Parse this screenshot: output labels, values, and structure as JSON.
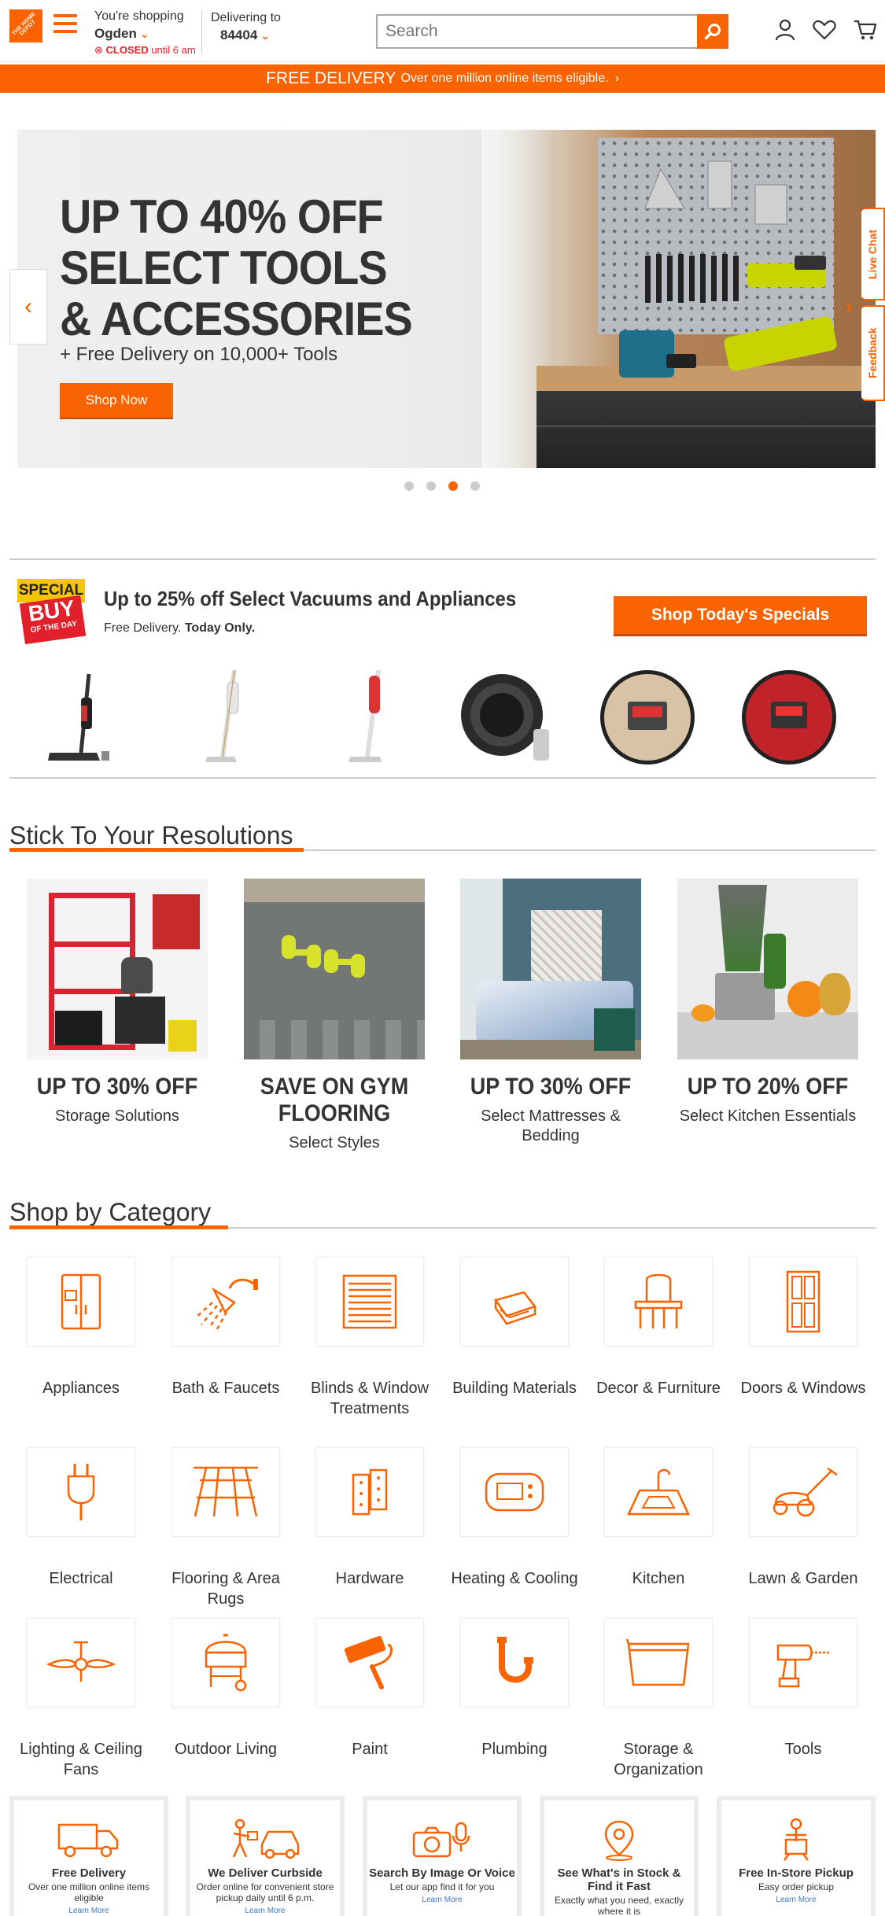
{
  "header": {
    "logo_text": "THE HOME DEPOT",
    "shopping_label": "You're shopping",
    "store_name": "Ogden",
    "store_status": "CLOSED",
    "store_hours": "until 6 am",
    "delivering_label": "Delivering to",
    "zip": "84404",
    "search_placeholder": "Search",
    "brand_color": "#f96302"
  },
  "promo_strip": {
    "headline": "FREE DELIVERY",
    "detail": "Over one million online items eligible.",
    "chevron": "›"
  },
  "hero": {
    "title_line1": "UP TO 40% OFF",
    "title_line2": "SELECT TOOLS",
    "title_line3": "& ACCESSORIES",
    "subtitle": "+ Free Delivery on 10,000+ Tools",
    "cta": "Shop Now",
    "active_slide": 3,
    "slide_count": 4
  },
  "side_tabs": {
    "live_chat": "Live Chat",
    "feedback": "Feedback"
  },
  "special_buy": {
    "badge_top": "SPECIAL",
    "badge_mid": "BUY",
    "badge_bottom": "OF THE DAY",
    "title": "Up to 25% off Select Vacuums and Appliances",
    "sub_prefix": "Free Delivery.",
    "sub_bold": "Today Only.",
    "cta": "Shop Today's Specials"
  },
  "resolutions": {
    "title": "Stick To Your Resolutions",
    "cards": [
      {
        "headline": "UP TO 30% OFF",
        "sub": "Storage Solutions"
      },
      {
        "headline": "SAVE ON GYM FLOORING",
        "sub": "Select Styles"
      },
      {
        "headline": "UP TO 30% OFF",
        "sub": "Select Mattresses & Bedding"
      },
      {
        "headline": "UP TO 20% OFF",
        "sub": "Select Kitchen Essentials"
      }
    ]
  },
  "categories": {
    "title": "Shop by Category",
    "items": [
      {
        "label": "Appliances",
        "icon": "fridge-icon"
      },
      {
        "label": "Bath & Faucets",
        "icon": "shower-icon"
      },
      {
        "label": "Blinds & Window Treatments",
        "icon": "blinds-icon"
      },
      {
        "label": "Building Materials",
        "icon": "lumber-icon"
      },
      {
        "label": "Decor & Furniture",
        "icon": "chair-icon"
      },
      {
        "label": "Doors & Windows",
        "icon": "door-icon"
      },
      {
        "label": "Electrical",
        "icon": "plug-icon"
      },
      {
        "label": "Flooring & Area Rugs",
        "icon": "flooring-icon"
      },
      {
        "label": "Hardware",
        "icon": "hinge-icon"
      },
      {
        "label": "Heating & Cooling",
        "icon": "thermostat-icon"
      },
      {
        "label": "Kitchen",
        "icon": "sink-icon"
      },
      {
        "label": "Lawn & Garden",
        "icon": "mower-icon"
      },
      {
        "label": "Lighting & Ceiling Fans",
        "icon": "ceiling-fan-icon"
      },
      {
        "label": "Outdoor Living",
        "icon": "grill-icon"
      },
      {
        "label": "Paint",
        "icon": "paint-roller-icon"
      },
      {
        "label": "Plumbing",
        "icon": "pipe-icon"
      },
      {
        "label": "Storage & Organization",
        "icon": "storage-bin-icon"
      },
      {
        "label": "Tools",
        "icon": "drill-icon"
      }
    ]
  },
  "services": [
    {
      "title": "Free Delivery",
      "desc": "Over one million online items eligible",
      "link": "Learn More"
    },
    {
      "title": "We Deliver Curbside",
      "desc": "Order online for convenient store pickup daily until 6 p.m.",
      "link": "Learn More"
    },
    {
      "title": "Search By Image Or Voice",
      "desc": "Let our app find it for you",
      "link": "Learn More"
    },
    {
      "title": "See What's in Stock & Find it Fast",
      "desc": "Exactly what you need, exactly where it is",
      "link": ""
    },
    {
      "title": "Free In-Store Pickup",
      "desc": "Easy order pickup",
      "link": "Learn More"
    }
  ]
}
